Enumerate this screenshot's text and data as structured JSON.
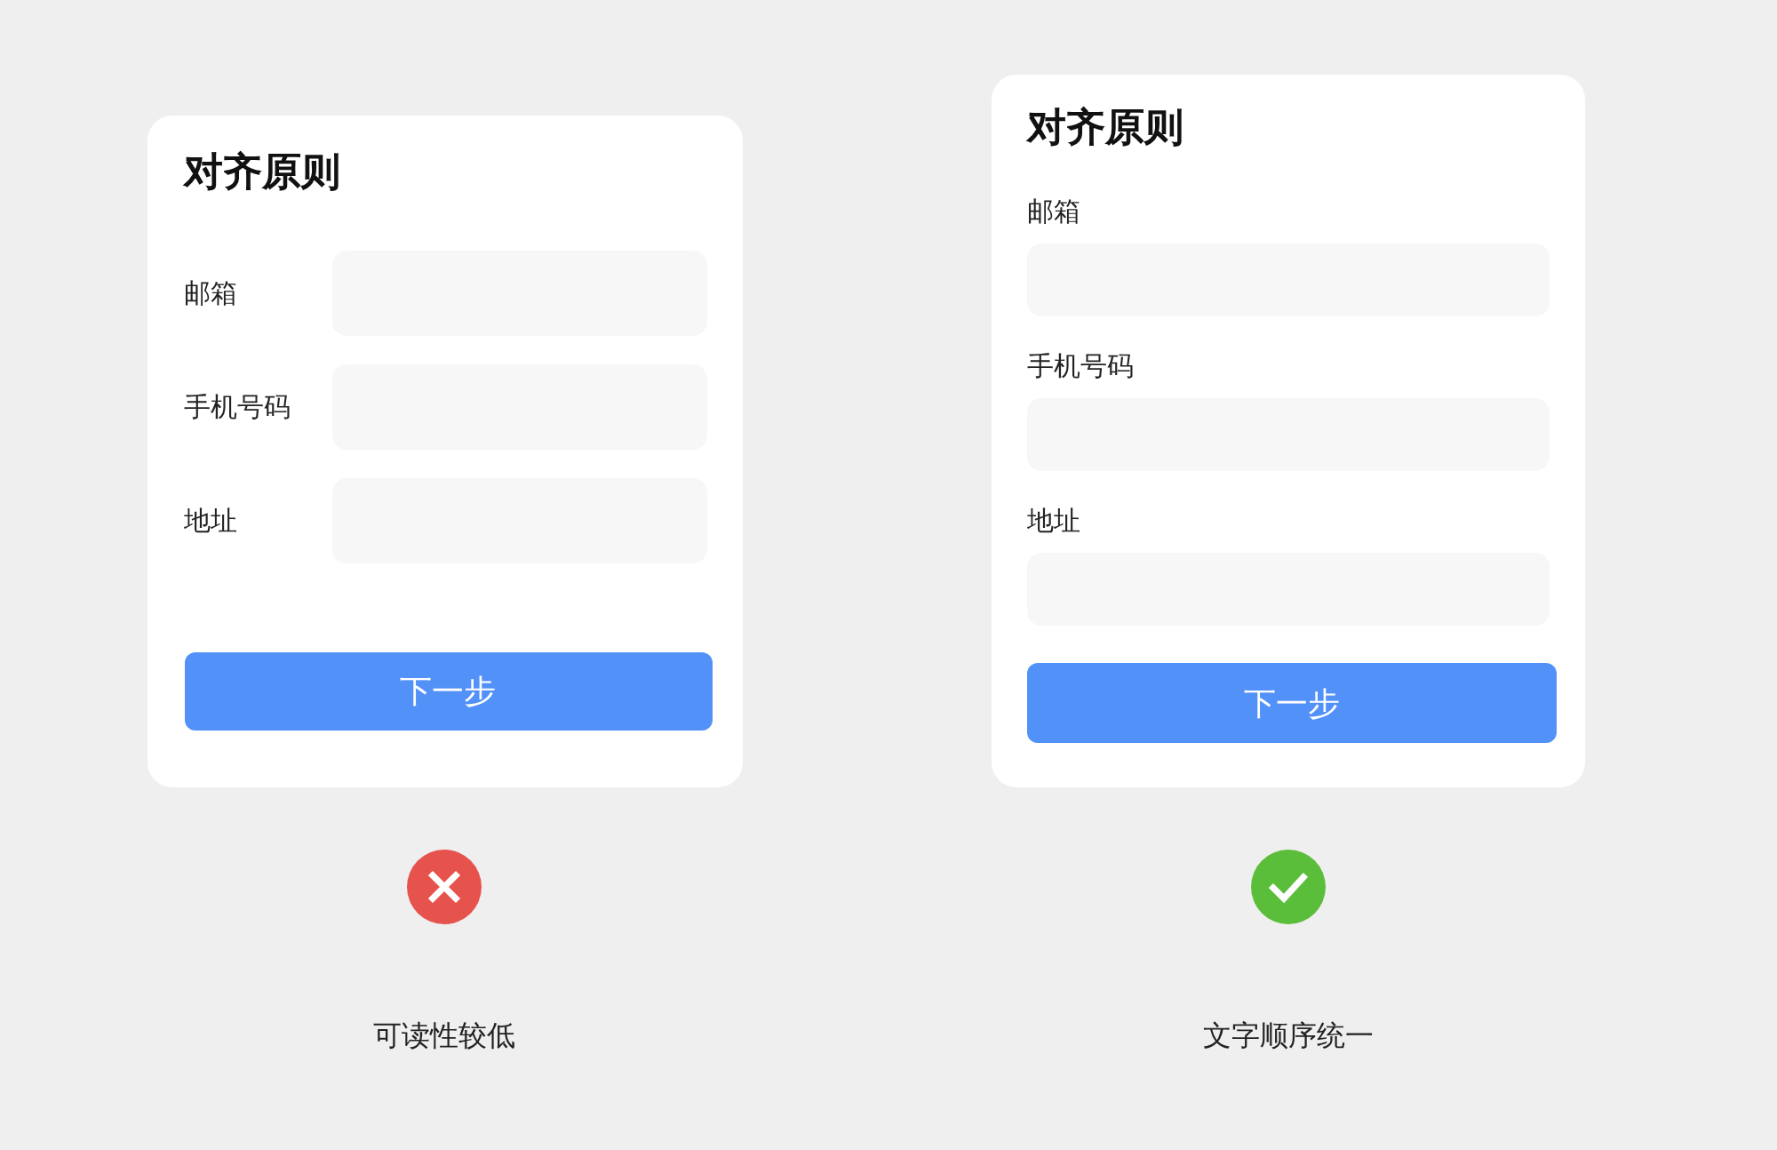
{
  "examples": [
    {
      "kind": "bad",
      "card": {
        "kind": "inline",
        "title": "对齐原则",
        "fields": [
          {
            "label": "邮箱"
          },
          {
            "label": "手机号码"
          },
          {
            "label": "地址"
          }
        ],
        "button": "下一步"
      },
      "verdict": "可读性较低"
    },
    {
      "kind": "good",
      "card": {
        "kind": "stacked",
        "title": "对齐原则",
        "fields": [
          {
            "label": "邮箱"
          },
          {
            "label": "手机号码"
          },
          {
            "label": "地址"
          }
        ],
        "button": "下一步"
      },
      "verdict": "文字顺序统一"
    }
  ]
}
